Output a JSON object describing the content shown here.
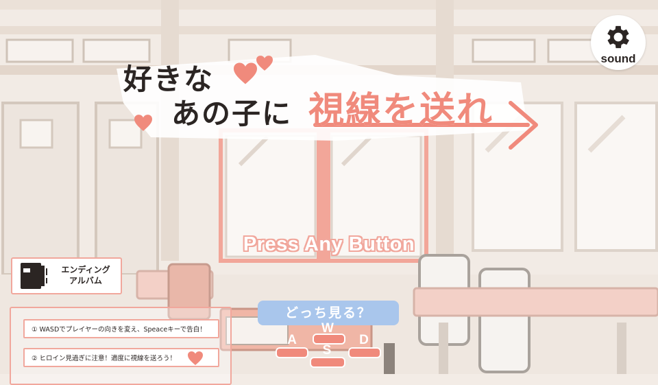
{
  "game": {
    "title_line1": "好きな",
    "title_line2": "あの子に",
    "title_line3": "視線を送れ",
    "press_prompt": "Press Any Button"
  },
  "sound": {
    "label": "sound",
    "icon": "gear-icon"
  },
  "album": {
    "label_line1": "エンディング",
    "label_line2": "アルバム",
    "icon": "book-icon"
  },
  "instructions": [
    "① WASDでプレイヤーの向きを変え、Speaceキーで告白！",
    "② ヒロイン見過ぎに注意！適度に視線を送ろう！"
  ],
  "direction": {
    "question": "どっち見る？",
    "keys": {
      "up": "W",
      "left": "A",
      "down": "S",
      "right": "D"
    }
  },
  "colors": {
    "accent_pink": "#f08a7c",
    "outline_pink": "#f1a79c",
    "badge_blue": "#a9c6ec",
    "ink": "#2b2523"
  }
}
